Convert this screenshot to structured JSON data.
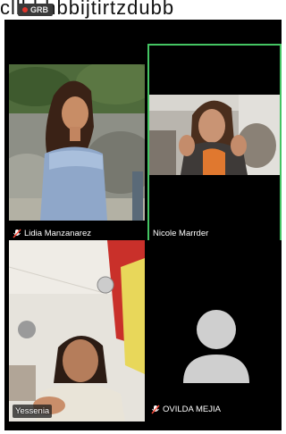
{
  "status": {
    "rec_label": "GRB",
    "top_text": "cllbbhbbijtirtzdubb"
  },
  "participants": [
    {
      "name": "Lidia Manzanarez",
      "muted": true,
      "active": false,
      "video": true
    },
    {
      "name": "Nicole Marrder",
      "muted": false,
      "active": true,
      "video": true
    },
    {
      "name": "Yessenia",
      "muted": false,
      "active": false,
      "video": true
    },
    {
      "name": "OVILDA MEJIA",
      "muted": true,
      "active": false,
      "video": false
    }
  ],
  "colors": {
    "active_border": "#44c463",
    "recording": "#e0362c",
    "mute": "#ff4d3d"
  }
}
